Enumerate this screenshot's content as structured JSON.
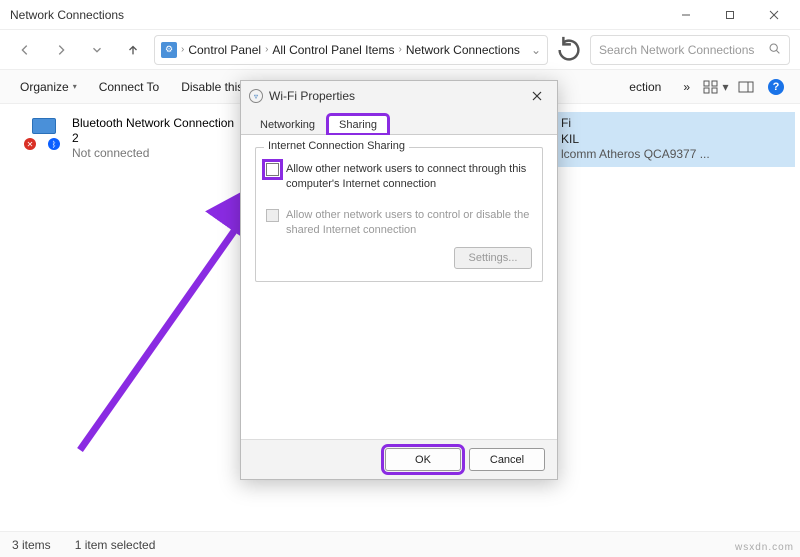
{
  "window": {
    "title": "Network Connections"
  },
  "breadcrumb": {
    "items": [
      "Control Panel",
      "All Control Panel Items",
      "Network Connections"
    ]
  },
  "search": {
    "placeholder": "Search Network Connections"
  },
  "commandbar": {
    "organize": "Organize",
    "connect_to": "Connect To",
    "disable": "Disable this n",
    "ection_trunc": "ection",
    "overflow": "»"
  },
  "connections": [
    {
      "name_line1": "Bluetooth Network Connection",
      "name_line2": "2",
      "status": "Not connected"
    },
    {
      "name_line1": "Fi",
      "name_line2": "KIL",
      "status": "lcomm Atheros QCA9377 ..."
    }
  ],
  "dialog": {
    "title": "Wi-Fi Properties",
    "tabs": {
      "networking": "Networking",
      "sharing": "Sharing"
    },
    "group_legend": "Internet Connection Sharing",
    "option1": "Allow other network users to connect through this computer's Internet connection",
    "option2": "Allow other network users to control or disable the shared Internet connection",
    "settings_btn": "Settings...",
    "ok": "OK",
    "cancel": "Cancel"
  },
  "statusbar": {
    "count": "3 items",
    "selected": "1 item selected"
  },
  "watermark": "wsxdn.com"
}
